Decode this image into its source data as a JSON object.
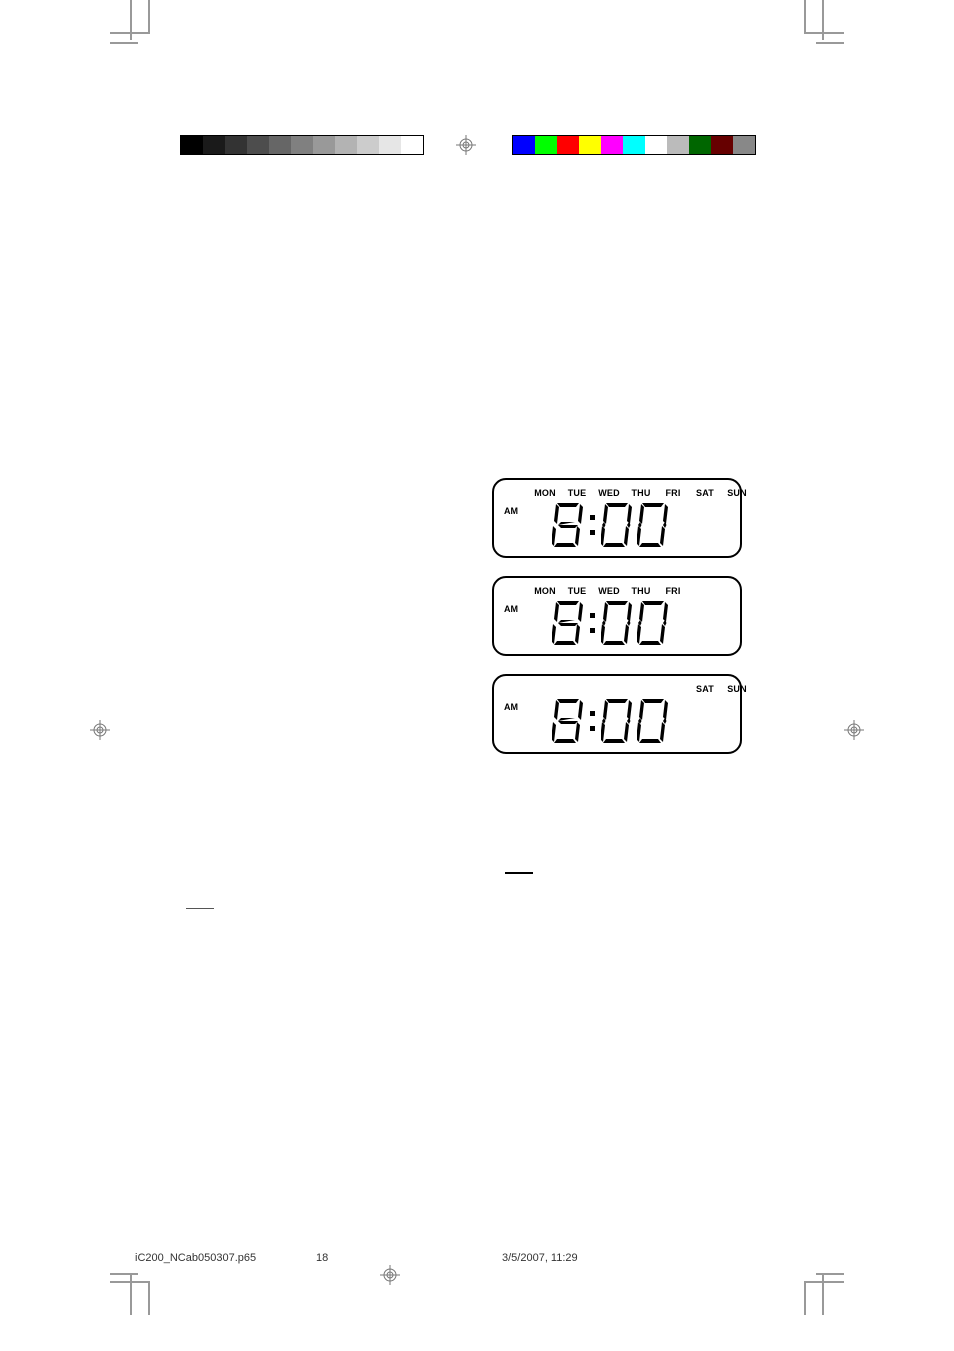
{
  "print": {
    "filename": "iC200_NCab050307.p65",
    "page_number": "18",
    "timestamp": "3/5/2007, 11:29"
  },
  "lcd_common": {
    "am_label": "AM",
    "time_hour": "8",
    "time_min1": "0",
    "time_min2": "0"
  },
  "days": {
    "mon": "MON",
    "tue": "TUE",
    "wed": "WED",
    "thu": "THU",
    "fri": "FRI",
    "sat": "SAT",
    "sun": "SUN"
  },
  "panels": [
    {
      "show": [
        "mon",
        "tue",
        "wed",
        "thu",
        "fri",
        "sat",
        "sun"
      ]
    },
    {
      "show": [
        "mon",
        "tue",
        "wed",
        "thu",
        "fri"
      ]
    },
    {
      "show": [
        "sat",
        "sun"
      ]
    }
  ],
  "colors": {
    "grays": [
      "#000",
      "#1a1a1a",
      "#333",
      "#4d4d4d",
      "#666",
      "#808080",
      "#999",
      "#b3b3b3",
      "#ccc",
      "#e6e6e6",
      "#fff"
    ],
    "swatches": [
      "#00f",
      "#0f0",
      "#f00",
      "#ff0",
      "#f0f",
      "#0ff",
      "#fff",
      "#bbb",
      "#060",
      "#600",
      "#888"
    ]
  }
}
